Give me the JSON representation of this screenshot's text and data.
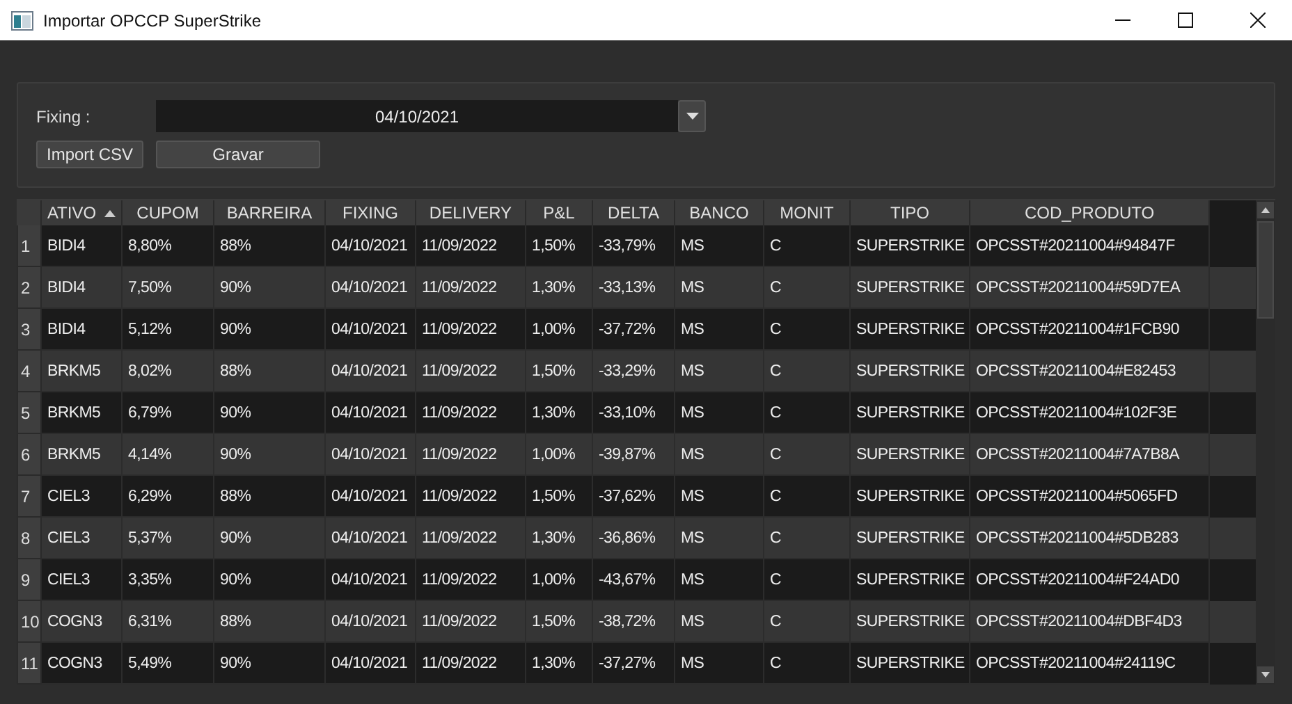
{
  "window": {
    "title": "Importar OPCCP SuperStrike"
  },
  "fixing": {
    "label": "Fixing :",
    "value": "04/10/2021"
  },
  "buttons": [
    "Import CSV",
    "Gravar"
  ],
  "table": {
    "columns": [
      {
        "label": "ATIVO",
        "sorted": true
      },
      {
        "label": "CUPOM",
        "sorted": false
      },
      {
        "label": "BARREIRA",
        "sorted": false
      },
      {
        "label": "FIXING",
        "sorted": false
      },
      {
        "label": "DELIVERY",
        "sorted": false
      },
      {
        "label": "P&L",
        "sorted": false
      },
      {
        "label": "DELTA",
        "sorted": false
      },
      {
        "label": "BANCO",
        "sorted": false
      },
      {
        "label": "MONIT",
        "sorted": false
      },
      {
        "label": "TIPO",
        "sorted": false
      },
      {
        "label": "COD_PRODUTO",
        "sorted": false
      }
    ],
    "rows": [
      {
        "number": "1",
        "cells": [
          "BIDI4",
          "8,80%",
          "88%",
          "04/10/2021",
          "11/09/2022",
          "1,50%",
          "-33,79%",
          "MS",
          "C",
          "SUPERSTRIKE",
          "OPCSST#20211004#94847F"
        ]
      },
      {
        "number": "2",
        "cells": [
          "BIDI4",
          "7,50%",
          "90%",
          "04/10/2021",
          "11/09/2022",
          "1,30%",
          "-33,13%",
          "MS",
          "C",
          "SUPERSTRIKE",
          "OPCSST#20211004#59D7EA"
        ]
      },
      {
        "number": "3",
        "cells": [
          "BIDI4",
          "5,12%",
          "90%",
          "04/10/2021",
          "11/09/2022",
          "1,00%",
          "-37,72%",
          "MS",
          "C",
          "SUPERSTRIKE",
          "OPCSST#20211004#1FCB90"
        ]
      },
      {
        "number": "4",
        "cells": [
          "BRKM5",
          "8,02%",
          "88%",
          "04/10/2021",
          "11/09/2022",
          "1,50%",
          "-33,29%",
          "MS",
          "C",
          "SUPERSTRIKE",
          "OPCSST#20211004#E82453"
        ]
      },
      {
        "number": "5",
        "cells": [
          "BRKM5",
          "6,79%",
          "90%",
          "04/10/2021",
          "11/09/2022",
          "1,30%",
          "-33,10%",
          "MS",
          "C",
          "SUPERSTRIKE",
          "OPCSST#20211004#102F3E"
        ]
      },
      {
        "number": "6",
        "cells": [
          "BRKM5",
          "4,14%",
          "90%",
          "04/10/2021",
          "11/09/2022",
          "1,00%",
          "-39,87%",
          "MS",
          "C",
          "SUPERSTRIKE",
          "OPCSST#20211004#7A7B8A"
        ]
      },
      {
        "number": "7",
        "cells": [
          "CIEL3",
          "6,29%",
          "88%",
          "04/10/2021",
          "11/09/2022",
          "1,50%",
          "-37,62%",
          "MS",
          "C",
          "SUPERSTRIKE",
          "OPCSST#20211004#5065FD"
        ]
      },
      {
        "number": "8",
        "cells": [
          "CIEL3",
          "5,37%",
          "90%",
          "04/10/2021",
          "11/09/2022",
          "1,30%",
          "-36,86%",
          "MS",
          "C",
          "SUPERSTRIKE",
          "OPCSST#20211004#5DB283"
        ]
      },
      {
        "number": "9",
        "cells": [
          "CIEL3",
          "3,35%",
          "90%",
          "04/10/2021",
          "11/09/2022",
          "1,00%",
          "-43,67%",
          "MS",
          "C",
          "SUPERSTRIKE",
          "OPCSST#20211004#F24AD0"
        ]
      },
      {
        "number": "10",
        "cells": [
          "COGN3",
          "6,31%",
          "88%",
          "04/10/2021",
          "11/09/2022",
          "1,50%",
          "-38,72%",
          "MS",
          "C",
          "SUPERSTRIKE",
          "OPCSST#20211004#DBF4D3"
        ]
      },
      {
        "number": "11",
        "cells": [
          "COGN3",
          "5,49%",
          "90%",
          "04/10/2021",
          "11/09/2022",
          "1,30%",
          "-37,27%",
          "MS",
          "C",
          "SUPERSTRIKE",
          "OPCSST#20211004#24119C"
        ]
      }
    ]
  }
}
